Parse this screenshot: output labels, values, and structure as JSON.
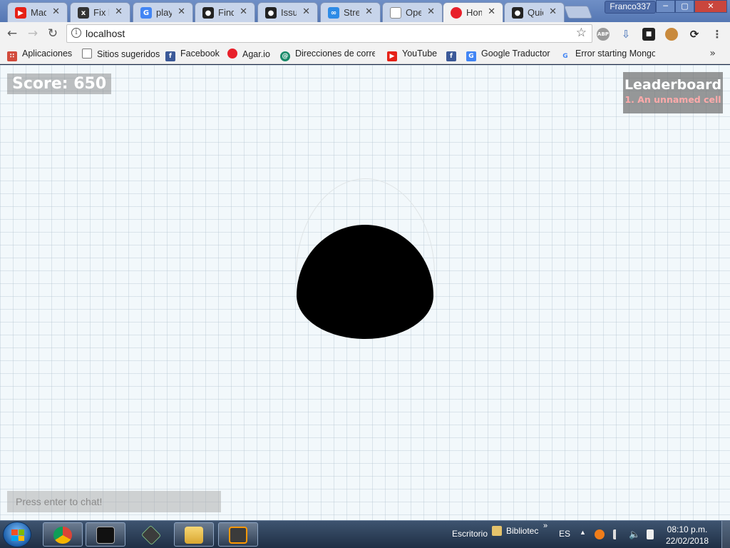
{
  "browser": {
    "tabs": [
      {
        "label": "Mad",
        "icon": "youtube-icon",
        "color": "#e62117"
      },
      {
        "label": "Fix b",
        "icon": "github-error-icon",
        "color": "#333333"
      },
      {
        "label": "playe",
        "icon": "google-icon",
        "color": "#4285f4"
      },
      {
        "label": "Find",
        "icon": "github-icon",
        "color": "#222222"
      },
      {
        "label": "Issue",
        "icon": "github-icon",
        "color": "#222222"
      },
      {
        "label": "Strea",
        "icon": "stream-icon",
        "color": "#2d8be6"
      },
      {
        "label": "Ope",
        "icon": "page-icon",
        "color": "#888888"
      },
      {
        "label": "Hom",
        "icon": "agar-dot-icon",
        "color": "#e8202a"
      },
      {
        "label": "Quic",
        "icon": "github-icon",
        "color": "#222222"
      }
    ],
    "profile_name": "Franco337",
    "url": "localhost",
    "bookmarks": [
      {
        "label": "Aplicaciones",
        "icon": "apps-grid-icon",
        "color": "#d24b3c"
      },
      {
        "label": "Sitios sugeridos",
        "icon": "page-icon",
        "color": "#888888"
      },
      {
        "label": "Facebook",
        "icon": "facebook-icon",
        "color": "#3b5998"
      },
      {
        "label": "Agar.io",
        "icon": "agar-dot-icon",
        "color": "#e8202a"
      },
      {
        "label": "Direcciones de correc",
        "icon": "mail-icon",
        "color": "#1a8a6a"
      },
      {
        "label": "YouTube",
        "icon": "youtube-icon",
        "color": "#e62117"
      },
      {
        "label": "",
        "icon": "facebook-icon",
        "color": "#3b5998"
      },
      {
        "label": "Google Traductor",
        "icon": "translate-icon",
        "color": "#4285f4"
      },
      {
        "label": "Error starting Mongo",
        "icon": "google-icon",
        "color": "#4285f4"
      }
    ]
  },
  "game": {
    "score": "Score: 650",
    "leaderboard": {
      "title": "Leaderboard",
      "entries": [
        "1. An unnamed cell"
      ]
    },
    "chat_placeholder": "Press enter to chat!",
    "cell_color": "#000000",
    "background_color": "#f2f8fb"
  },
  "taskbar": {
    "toolbar_label": "Escritorio",
    "library_label": "Bibliotec",
    "language": "ES",
    "time": "08:10 p.m.",
    "date": "22/02/2018"
  }
}
